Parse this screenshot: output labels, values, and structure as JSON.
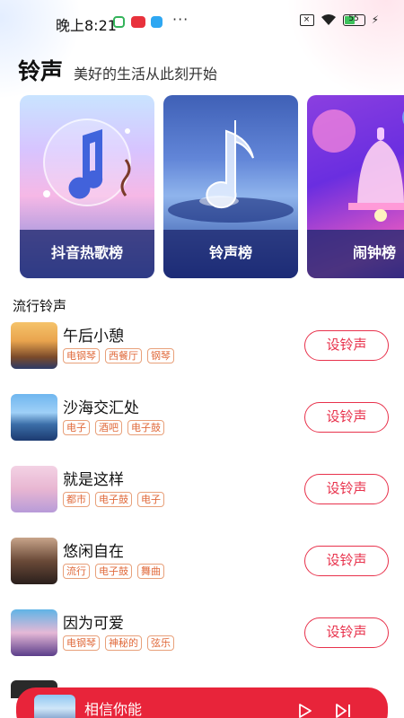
{
  "status_bar": {
    "time": "晚上8:21",
    "more": "···",
    "sim_label": "×",
    "battery_level": "55",
    "colors": {
      "app_green": "#33b35a",
      "app_red": "#e8323c",
      "app_blue": "#2ea7f2"
    }
  },
  "header": {
    "title": "铃声",
    "subtitle": "美好的生活从此刻开始"
  },
  "categories": [
    {
      "label": "抖音热歌榜",
      "icon": "music-note-bubble-art"
    },
    {
      "label": "铃声榜",
      "icon": "glass-music-note-art"
    },
    {
      "label": "闹钟榜",
      "icon": "alarm-bell-art"
    }
  ],
  "section_title": "流行铃声",
  "songs": [
    {
      "name": "午后小憩",
      "tags": [
        "电钢琴",
        "西餐厅",
        "钢琴"
      ],
      "button": "设铃声"
    },
    {
      "name": "沙海交汇处",
      "tags": [
        "电子",
        "酒吧",
        "电子鼓"
      ],
      "button": "设铃声"
    },
    {
      "name": "就是这样",
      "tags": [
        "都市",
        "电子鼓",
        "电子"
      ],
      "button": "设铃声"
    },
    {
      "name": "悠闲自在",
      "tags": [
        "流行",
        "电子鼓",
        "舞曲"
      ],
      "button": "设铃声"
    },
    {
      "name": "因为可爱",
      "tags": [
        "电钢琴",
        "神秘的",
        "弦乐"
      ],
      "button": "设铃声"
    }
  ],
  "player": {
    "title": "相信你能",
    "accent_color": "#e8243a"
  },
  "colors": {
    "accent": "#e8324c",
    "tag_text": "#e06a3b",
    "tag_border": "#e8a07a"
  }
}
